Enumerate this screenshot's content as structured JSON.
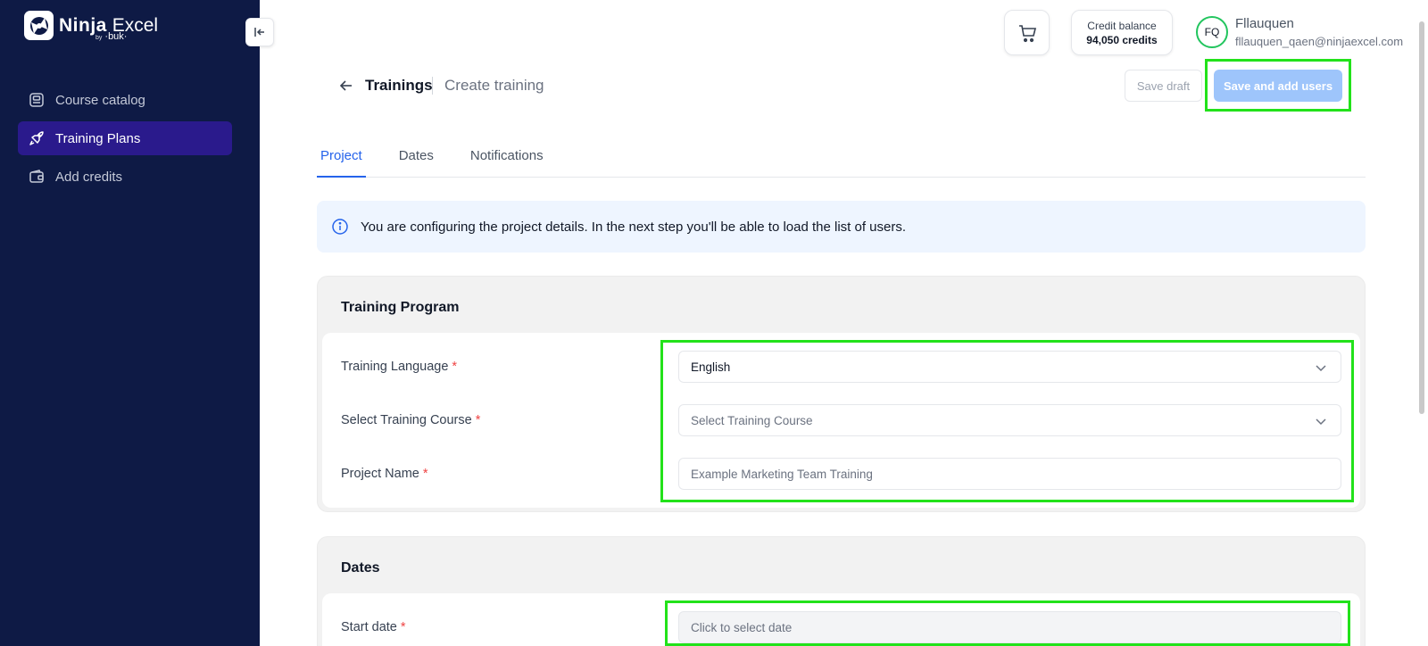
{
  "brand": {
    "name_bold": "Ninja",
    "name_regular": "Excel",
    "by": "by",
    "partner": "·buk·"
  },
  "sidebar": {
    "items": [
      {
        "label": "Course catalog",
        "icon": "catalog-icon",
        "active": false
      },
      {
        "label": "Training Plans",
        "icon": "rocket-icon",
        "active": true
      },
      {
        "label": "Add credits",
        "icon": "wallet-icon",
        "active": false
      }
    ]
  },
  "header": {
    "credit_label": "Credit balance",
    "credit_value": "94,050 credits",
    "avatar_initials": "FQ",
    "user_name": "Fllauquen",
    "user_email": "fllauquen_qaen@ninjaexcel.com"
  },
  "page": {
    "breadcrumb_main": "Trainings",
    "breadcrumb_sub": "Create training",
    "save_draft": "Save draft",
    "save_and_add_users": "Save and add users"
  },
  "tabs": [
    {
      "label": "Project",
      "active": true
    },
    {
      "label": "Dates",
      "active": false
    },
    {
      "label": "Notifications",
      "active": false
    }
  ],
  "info_banner": "You are configuring the project details. In the next step you'll be able to load the list of users.",
  "training_program": {
    "title": "Training Program",
    "language_label": "Training Language",
    "language_value": "English",
    "course_label": "Select Training Course",
    "course_placeholder": "Select Training Course",
    "project_name_label": "Project Name",
    "project_name_placeholder": "Example Marketing Team Training",
    "required_mark": "*"
  },
  "dates": {
    "title": "Dates",
    "start_label": "Start date",
    "start_placeholder": "Click to select date",
    "required_mark": "*"
  },
  "colors": {
    "sidebar_bg": "#0e1a45",
    "active_nav": "#2a1a8c",
    "primary_disabled": "#9ec5fb",
    "tab_active": "#2563eb",
    "highlight": "#22e21a"
  }
}
